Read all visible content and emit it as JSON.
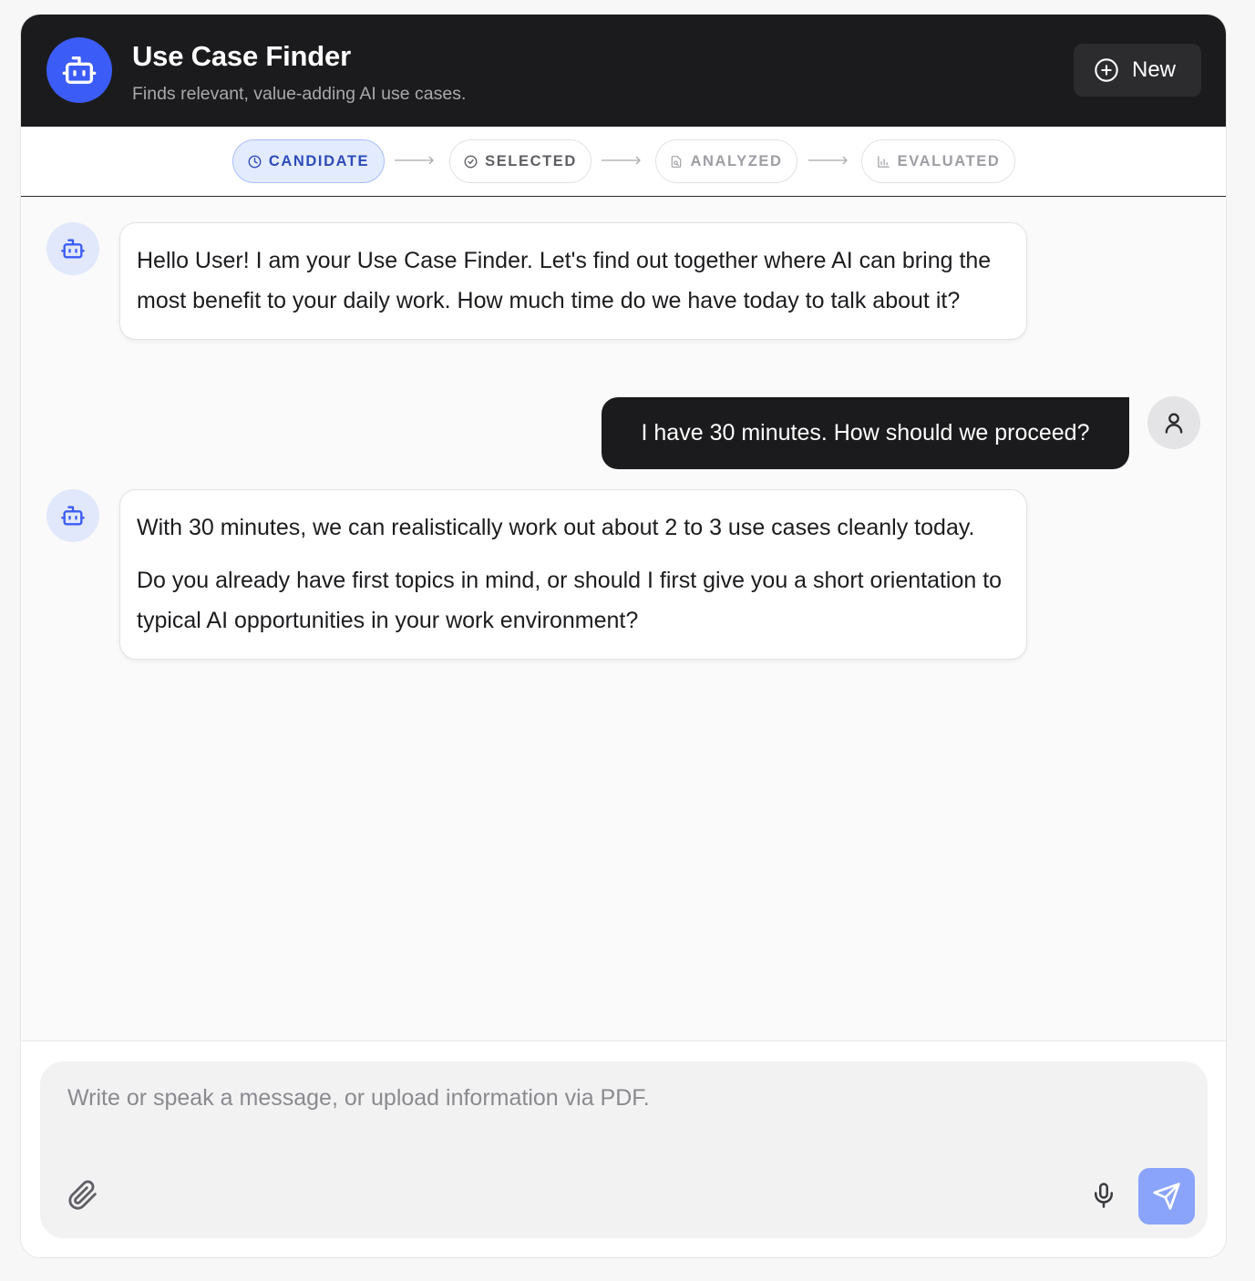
{
  "header": {
    "title": "Use Case Finder",
    "subtitle": "Finds relevant, value-adding AI use cases.",
    "avatar_icon": "robot-icon",
    "new_button_label": "New",
    "new_button_icon": "plus-circle-icon"
  },
  "stepper": {
    "steps": [
      {
        "label": "CANDIDATE",
        "icon": "clock-icon",
        "state": "active"
      },
      {
        "label": "SELECTED",
        "icon": "check-circle-icon",
        "state": "upcoming"
      },
      {
        "label": "ANALYZED",
        "icon": "document-search-icon",
        "state": "upcoming"
      },
      {
        "label": "EVALUATED",
        "icon": "bar-chart-icon",
        "state": "upcoming"
      }
    ]
  },
  "messages": [
    {
      "role": "assistant",
      "paragraphs": [
        "Hello User! I am your Use Case Finder. Let's find out together where AI can bring the most benefit to your daily work. How much time do we have today to talk about it?"
      ]
    },
    {
      "role": "user",
      "text": "I have 30 minutes. How should we proceed?"
    },
    {
      "role": "assistant",
      "paragraphs": [
        "With 30 minutes, we can realistically work out about 2 to 3 use cases cleanly today.",
        "Do you already have first topics in mind, or should I first give you a short orientation to typical AI opportunities in your work environment?"
      ]
    }
  ],
  "composer": {
    "placeholder": "Write or speak a message, or upload information via PDF.",
    "value": ""
  },
  "colors": {
    "header_bg": "#1b1b1d",
    "accent": "#3b5cf6",
    "send_button": "#8aa4fb",
    "active_step_bg": "#e3ebff"
  }
}
